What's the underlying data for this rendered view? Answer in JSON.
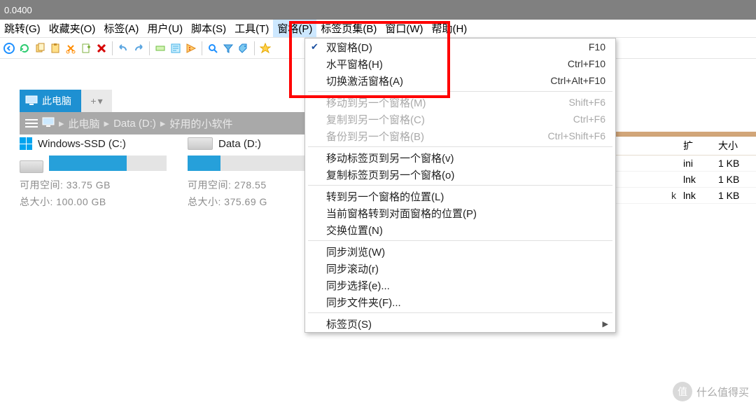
{
  "titlebar": {
    "text": "0.0400"
  },
  "menubar": {
    "items": [
      {
        "label": "跳转(G)"
      },
      {
        "label": "收藏夹(O)"
      },
      {
        "label": "标签(A)"
      },
      {
        "label": "用户(U)"
      },
      {
        "label": "脚本(S)"
      },
      {
        "label": "工具(T)"
      },
      {
        "label": "窗格(P)"
      },
      {
        "label": "标签页集(B)"
      },
      {
        "label": "窗口(W)"
      },
      {
        "label": "帮助(H)"
      }
    ],
    "open_index": 6
  },
  "toolbar": {
    "icons": [
      "back-icon",
      "refresh-icon",
      "copy-icon",
      "paste-icon",
      "cut-icon",
      "new-file-icon",
      "delete-icon",
      "sep",
      "undo-icon",
      "redo-icon",
      "sep",
      "rename-icon",
      "properties-icon",
      "pizza-icon",
      "sep",
      "search-icon",
      "filter-icon",
      "tag-icon",
      "sep",
      "star-icon"
    ],
    "colors": {
      "back": "#1e90ff",
      "refresh": "#2ecc71",
      "copy": "#f4a300",
      "paste": "#f4a300",
      "cut": "#ff8c00",
      "new": "#7fb140",
      "delete": "#d60000",
      "undo": "#5aa5e0",
      "redo": "#5aa5e0",
      "rename": "#6fbf44",
      "properties": "#41b0e8",
      "pizza": "#ff9a1f",
      "search": "#1e90ff",
      "filter": "#1e82d2",
      "tag": "#1e82d2",
      "star": "#ffaa00"
    }
  },
  "tab": {
    "label": "此电脑",
    "add_label": "+",
    "dropdown_label": "▾"
  },
  "breadcrumb": {
    "items": [
      "此电脑",
      "Data (D:)",
      "好用的小软件"
    ]
  },
  "drives": [
    {
      "name": "Windows-SSD (C:)",
      "free_label": "可用空间: 33.75 GB",
      "total_label": "总大小: 100.00 GB",
      "fill_pct": 66
    },
    {
      "name": "Data (D:)",
      "free_label": "可用空间: 278.55",
      "total_label": "总大小: 375.69 G",
      "fill_pct": 26
    }
  ],
  "dropdown": {
    "groups": [
      [
        {
          "label": "双窗格(D)",
          "shortcut": "F10",
          "checked": true
        },
        {
          "label": "水平窗格(H)",
          "shortcut": "Ctrl+F10"
        },
        {
          "label": "切换激活窗格(A)",
          "shortcut": "Ctrl+Alt+F10"
        }
      ],
      [
        {
          "label": "移动到另一个窗格(M)",
          "shortcut": "Shift+F6",
          "disabled": true
        },
        {
          "label": "复制到另一个窗格(C)",
          "shortcut": "Ctrl+F6",
          "disabled": true
        },
        {
          "label": "备份到另一个窗格(B)",
          "shortcut": "Ctrl+Shift+F6",
          "disabled": true
        }
      ],
      [
        {
          "label": "移动标签页到另一个窗格(v)"
        },
        {
          "label": "复制标签页到另一个窗格(o)"
        }
      ],
      [
        {
          "label": "转到另一个窗格的位置(L)"
        },
        {
          "label": "当前窗格转到对面窗格的位置(P)"
        },
        {
          "label": "交换位置(N)"
        }
      ],
      [
        {
          "label": "同步浏览(W)"
        },
        {
          "label": "同步滚动(r)"
        },
        {
          "label": "同步选择(e)..."
        },
        {
          "label": "同步文件夹(F)..."
        }
      ],
      [
        {
          "label": "标签页(S)",
          "submenu": true
        }
      ]
    ]
  },
  "right_pane": {
    "headers": {
      "name": "",
      "ext": "扩",
      "size": "大小"
    },
    "rows": [
      {
        "name": "",
        "ext": "ini",
        "size": "1 KB"
      },
      {
        "name": "",
        "ext": "lnk",
        "size": "1 KB"
      },
      {
        "name": "k",
        "ext": "lnk",
        "size": "1 KB"
      }
    ]
  },
  "watermark": {
    "badge": "值",
    "text": "什么值得买"
  }
}
